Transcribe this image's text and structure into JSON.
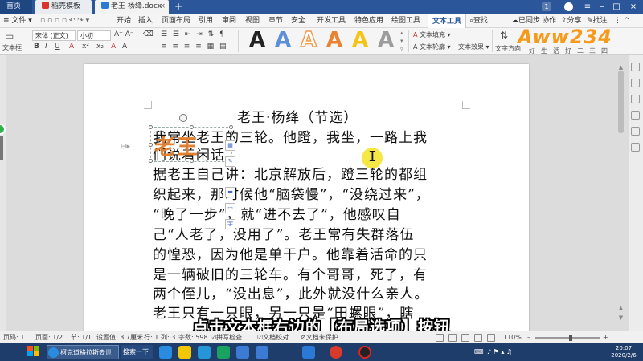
{
  "tabs": {
    "home": "首页",
    "template": "稻壳模板",
    "document": "老王 杨绛.docx",
    "badge": "1"
  },
  "menu": {
    "file": "文件",
    "items": [
      "开始",
      "插入",
      "页面布局",
      "引用",
      "审阅",
      "视图",
      "章节",
      "安全",
      "开发工具",
      "特色应用",
      "绘图工具"
    ],
    "active": "文本工具",
    "search": "查找",
    "sync": "已同步",
    "collab": "协作",
    "share": "分享",
    "comment": "批注"
  },
  "ribbon": {
    "font_name": "宋体 (正文)",
    "font_size": "小初",
    "textbox_label": "文本框",
    "style_letter": "A",
    "text_fill": "文本填充",
    "text_outline": "文本轮廓",
    "text_effect": "文本效果",
    "text_direction": "文字方向",
    "style_colors": [
      "#222222",
      "#5b8fd9",
      "#f19b4f",
      "#e8842f",
      "#f4c316",
      "#9c9c9c"
    ]
  },
  "logo": {
    "text": "Aww234",
    "tagline": "好生活好二三四"
  },
  "document": {
    "title": "老王·杨绛（节选）",
    "lines": [
      "我常坐老王的三轮。他蹬，我坐，一路上我",
      "们说着闲话。",
      "据老王自己讲：北京解放后，蹬三轮的都组",
      "织起来，那时候他“脑袋慢”，“没绕过来”，",
      "“晚了一步”，就“进不去了”，他感叹自",
      "己“人老了，没用了”。老王常有失群落伍",
      "的惶恐，因为他是单干户。他靠着活命的只",
      "是一辆破旧的三轮车。有个哥哥，死了，有",
      "两个侄儿，“没出息”，此外就没什么亲人。",
      "老王只有一只眼，另一只是“田螺眼”，瞎"
    ],
    "textbox_text": "老王",
    "float_tools": [
      "",
      "",
      "",
      "字"
    ]
  },
  "caption": "点击文本框右边的【布局选项】按钮",
  "status": {
    "page": "页码: 1",
    "pages": "页面: 1/2",
    "section": "节: 1/1",
    "setting": "设置值: 3.7厘米",
    "row": "行: 1",
    "col": "列: 3",
    "words": "字数: 598",
    "spell": "拼写检查",
    "proof": "文档校对",
    "protect": "文档未保护",
    "zoom": "110%",
    "zoom_level": 0.55
  },
  "taskbar": {
    "browser_label": "柯克道格拉斯去世",
    "search_label": "搜索一下",
    "time": "20:07",
    "date": "2020/2/6",
    "icon_colors": [
      "#2a8ce0",
      "#f4c800",
      "#2596d8",
      "#1aa260",
      "#3b7bd4",
      "#d83b2b",
      "#333333"
    ]
  }
}
